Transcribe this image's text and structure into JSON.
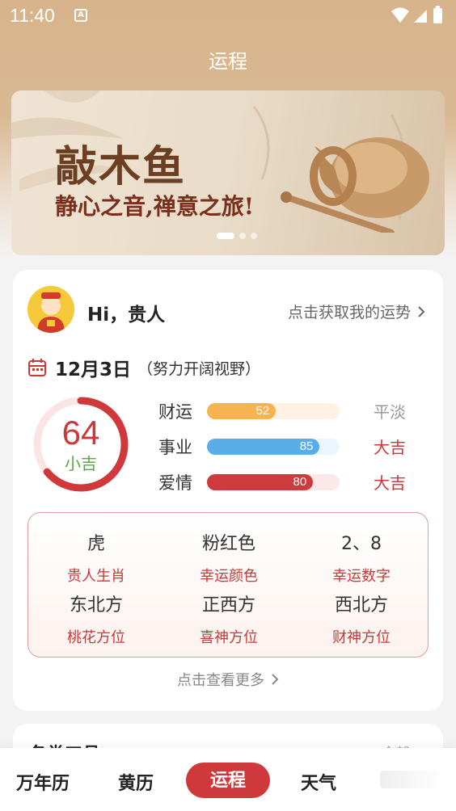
{
  "status_bar": {
    "time": "11:40",
    "notification_icon": "a-icon"
  },
  "header": {
    "title": "运程"
  },
  "banner": {
    "title": "敲木鱼",
    "subtitle": "静心之音,禅意之旅!",
    "dots": 3,
    "active_dot": 0
  },
  "fortune_card": {
    "greeting": "Hi，贵人",
    "get_fortune_link": "点击获取我的运势",
    "date": "12月3日",
    "date_note": "（努力开阔视野）",
    "score": {
      "value": "64",
      "label": "小吉",
      "fraction": 0.64
    },
    "bars": [
      {
        "label": "财运",
        "value": "52",
        "percent": 0.52,
        "level": "平淡",
        "fill": "#f6b34f",
        "track": "#fdf1e3",
        "level_color": "#999999"
      },
      {
        "label": "事业",
        "value": "85",
        "percent": 0.85,
        "level": "大吉",
        "fill": "#5aaee8",
        "track": "#eaf5fd",
        "level_color": "#c8393a"
      },
      {
        "label": "爱情",
        "value": "80",
        "percent": 0.8,
        "level": "大吉",
        "fill": "#cf3b3d",
        "track": "#fbe8e8",
        "level_color": "#c8393a"
      }
    ],
    "info": [
      {
        "value": "虎",
        "label": "贵人生肖"
      },
      {
        "value": "粉红色",
        "label": "幸运颜色"
      },
      {
        "value": "2、8",
        "label": "幸运数字"
      },
      {
        "value": "东北方",
        "label": "桃花方位"
      },
      {
        "value": "正西方",
        "label": "喜神方位"
      },
      {
        "value": "西北方",
        "label": "财神方位"
      }
    ],
    "more_link": "点击查看更多"
  },
  "tools_card": {
    "title": "各类工具",
    "more": "全部 >"
  },
  "bottom_nav": {
    "items": [
      "万年历",
      "黄历",
      "运程",
      "天气"
    ],
    "active": "运程"
  },
  "colors": {
    "accent": "#c8393a",
    "header_bg": "#d7b48b"
  }
}
